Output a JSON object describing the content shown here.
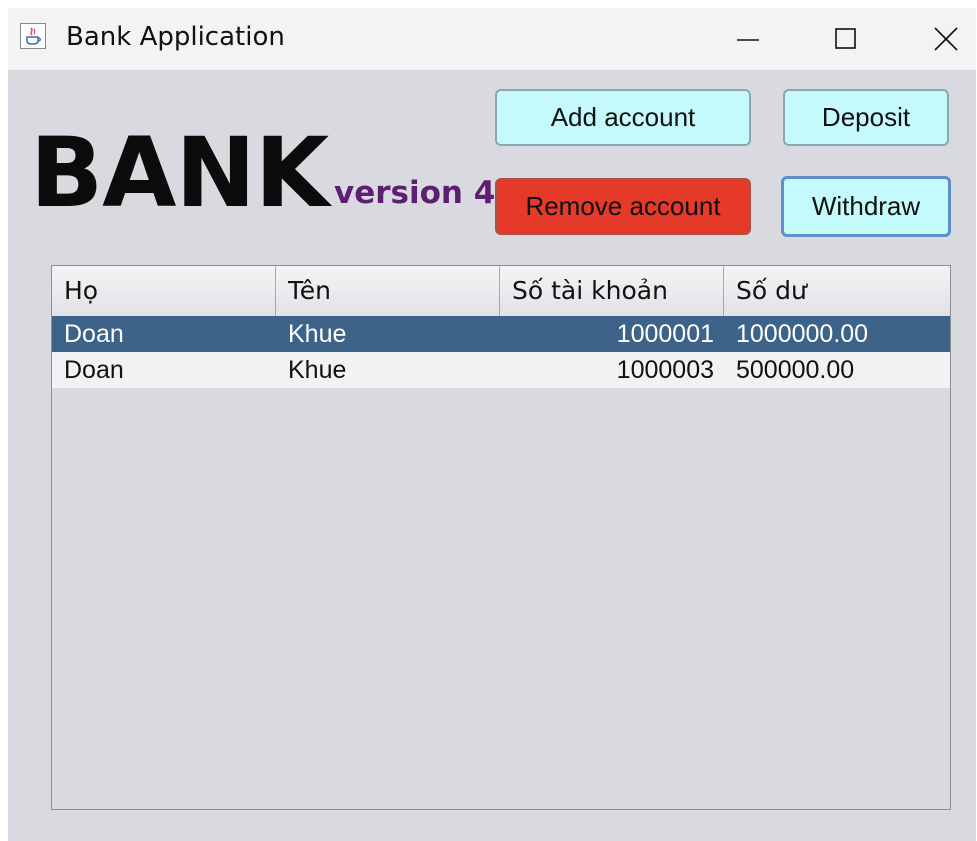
{
  "window": {
    "title": "Bank Application",
    "controls": {
      "minimize": "minimize",
      "maximize": "maximize",
      "close": "close"
    }
  },
  "header": {
    "logo": "BANK",
    "version": "version 4"
  },
  "buttons": {
    "add_account": "Add account",
    "deposit": "Deposit",
    "remove_account": "Remove account",
    "withdraw": "Withdraw"
  },
  "table": {
    "columns": [
      "Họ",
      "Tên",
      "Số tài khoản",
      "Số dư"
    ],
    "rows": [
      [
        "Doan",
        "Khue",
        "1000001",
        "1000000.00"
      ],
      [
        "Doan",
        "Khue",
        "1000003",
        "500000.00"
      ]
    ],
    "selected_row": 0
  },
  "colors": {
    "accent_button": "#c4fafc",
    "danger_button": "#e5392a",
    "selected_row": "#3e6388",
    "version_text": "#5e1f73",
    "window_bg": "#d9dadf"
  }
}
